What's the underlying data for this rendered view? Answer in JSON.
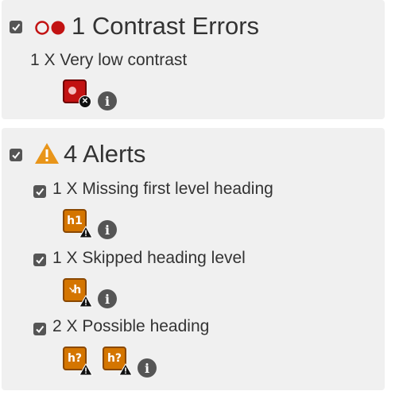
{
  "contrast": {
    "checked": true,
    "count_label": "1 Contrast Errors",
    "items": [
      {
        "label": "1 X Very low contrast",
        "icons": [
          "very-low-contrast-icon"
        ]
      }
    ]
  },
  "alerts": {
    "checked": true,
    "count_label": "4 Alerts",
    "items": [
      {
        "checked": true,
        "label": "1 X Missing first level heading",
        "icon_text": "h1"
      },
      {
        "checked": true,
        "label": "1 X Skipped heading level",
        "icon_text": "h"
      },
      {
        "checked": true,
        "label": "2 X Possible heading",
        "icon_text": "h?"
      }
    ]
  },
  "colors": {
    "panel_bg": "#f0f0f0",
    "error_red": "#c21212",
    "alert_orange": "#d47500",
    "warning_yellow": "#e8951a",
    "text": "#333333",
    "info_icon": "#555555"
  }
}
